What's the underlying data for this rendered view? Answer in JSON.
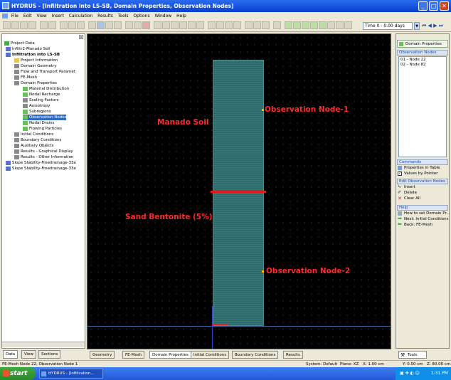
{
  "window": {
    "title": "HYDRUS - [Infiltration into LS-SB, Domain Properties, Observation Nodes]",
    "minimize": "_",
    "maximize": "□",
    "close": "✕"
  },
  "menu": [
    "File",
    "Edit",
    "View",
    "Insert",
    "Calculation",
    "Results",
    "Tools",
    "Options",
    "Window",
    "Help"
  ],
  "toolbar": {
    "time_value": "Time 0 - 0.00 days"
  },
  "tree": {
    "items": [
      {
        "label": "Project Data",
        "indent": 0
      },
      {
        "label": "Infiltr2-Manado Soil",
        "indent": 1
      },
      {
        "label": "Infiltration into LS-SB",
        "indent": 1
      },
      {
        "label": "Project Information",
        "indent": 2
      },
      {
        "label": "Domain Geometry",
        "indent": 2
      },
      {
        "label": "Flow and Transport Paramet",
        "indent": 2
      },
      {
        "label": "FE-Mesh",
        "indent": 2
      },
      {
        "label": "Domain Properties",
        "indent": 2
      },
      {
        "label": "Material Distribution",
        "indent": 3
      },
      {
        "label": "Nodal Recharge",
        "indent": 3
      },
      {
        "label": "Scaling Factors",
        "indent": 3
      },
      {
        "label": "Anisotropy",
        "indent": 3
      },
      {
        "label": "Subregions",
        "indent": 3
      },
      {
        "label": "Observation Nodes",
        "indent": 3
      },
      {
        "label": "Nodal Drains",
        "indent": 3
      },
      {
        "label": "Flowing Particles",
        "indent": 3
      },
      {
        "label": "Initial Conditions",
        "indent": 2
      },
      {
        "label": "Boundary Conditions",
        "indent": 2
      },
      {
        "label": "Auxiliary Objects",
        "indent": 2
      },
      {
        "label": "Results - Graphical Display",
        "indent": 2
      },
      {
        "label": "Results - Other Information",
        "indent": 2
      },
      {
        "label": "Slope Stability-Freedrainage-33a",
        "indent": 1
      },
      {
        "label": "Slope Stability-Freedrainage-33a",
        "indent": 1
      }
    ]
  },
  "left_tabs": [
    "Data",
    "View",
    "Sections"
  ],
  "canvas": {
    "labels": {
      "manado": "Manado Soil",
      "sand": "Sand Bentonite (5%)",
      "obs1": "Observation Node-1",
      "obs2": "Observation Node-2"
    }
  },
  "canvas_tabs": [
    "Geometry",
    "FE-Mesh",
    "Domain Properties",
    "Initial Conditions",
    "Boundary Conditions",
    "Results"
  ],
  "right": {
    "domain_properties": "Domain Properties",
    "obs_header": "Observation Nodes",
    "obs_list": [
      "01 - Node 22",
      "02 - Node 82"
    ],
    "commands_header": "Commands",
    "commands": [
      "Properties in Table",
      "Values by Pointer"
    ],
    "edit_header": "Edit Observation Nodes",
    "edit": [
      "Insert",
      "Delete",
      "Clear All"
    ],
    "help_header": "Help",
    "help": [
      "How to set Domain Pr...",
      "Next: Initial Conditions",
      "Back: FE-Mesh"
    ],
    "tools_tab": "Tools"
  },
  "status": {
    "left": "FE-Mesh Node 22, Observation Node 1",
    "system": "System: Default",
    "plane": "Plane: XZ",
    "x": "X: 1.00 cm",
    "y": "Y: 0.00 cm",
    "z": "Z: 80.00 cm"
  },
  "taskbar": {
    "start": "start",
    "item": "HYDRUS - [Infiltration...",
    "clock": "1:31 PM"
  }
}
